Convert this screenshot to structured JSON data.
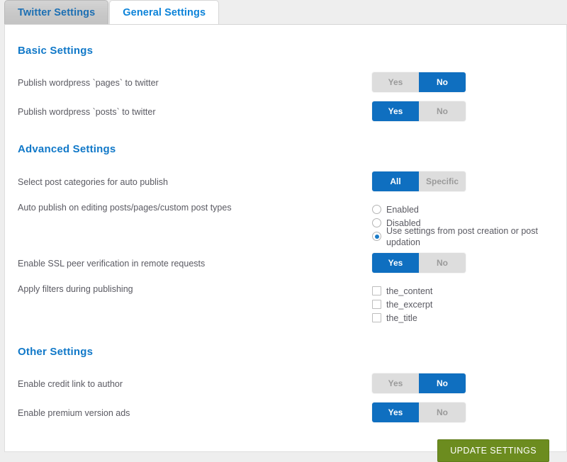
{
  "tabs": [
    {
      "label": "Twitter Settings",
      "active": false
    },
    {
      "label": "General Settings",
      "active": true
    }
  ],
  "sections": {
    "basic": {
      "title": "Basic Settings",
      "rows": {
        "publish_pages": {
          "label": "Publish wordpress `pages` to twitter",
          "yes": "Yes",
          "no": "No",
          "selected": "No"
        },
        "publish_posts": {
          "label": "Publish wordpress `posts` to twitter",
          "yes": "Yes",
          "no": "No",
          "selected": "Yes"
        }
      }
    },
    "advanced": {
      "title": "Advanced Settings",
      "rows": {
        "categories": {
          "label": "Select post categories for auto publish",
          "all": "All",
          "specific": "Specific",
          "selected": "All"
        },
        "auto_publish_edit": {
          "label": "Auto publish on editing posts/pages/custom post types",
          "options": [
            {
              "label": "Enabled",
              "checked": false
            },
            {
              "label": "Disabled",
              "checked": false
            },
            {
              "label": "Use settings from post creation or post updation",
              "checked": true
            }
          ]
        },
        "ssl": {
          "label": "Enable SSL peer verification in remote requests",
          "yes": "Yes",
          "no": "No",
          "selected": "Yes"
        },
        "filters": {
          "label": "Apply filters during publishing",
          "options": [
            {
              "label": "the_content",
              "checked": false
            },
            {
              "label": "the_excerpt",
              "checked": false
            },
            {
              "label": "the_title",
              "checked": false
            }
          ]
        }
      }
    },
    "other": {
      "title": "Other Settings",
      "rows": {
        "credit_link": {
          "label": "Enable credit link to author",
          "yes": "Yes",
          "no": "No",
          "selected": "No"
        },
        "premium_ads": {
          "label": "Enable premium version ads",
          "yes": "Yes",
          "no": "No",
          "selected": "Yes"
        }
      }
    }
  },
  "submit": {
    "label": "UPDATE SETTINGS"
  },
  "colors": {
    "accent_blue": "#0f6fc0",
    "heading_blue": "#1078c8",
    "toggle_off": "#dddddd",
    "submit_green": "#6c8c1f",
    "page_bg": "#eeeeee"
  }
}
